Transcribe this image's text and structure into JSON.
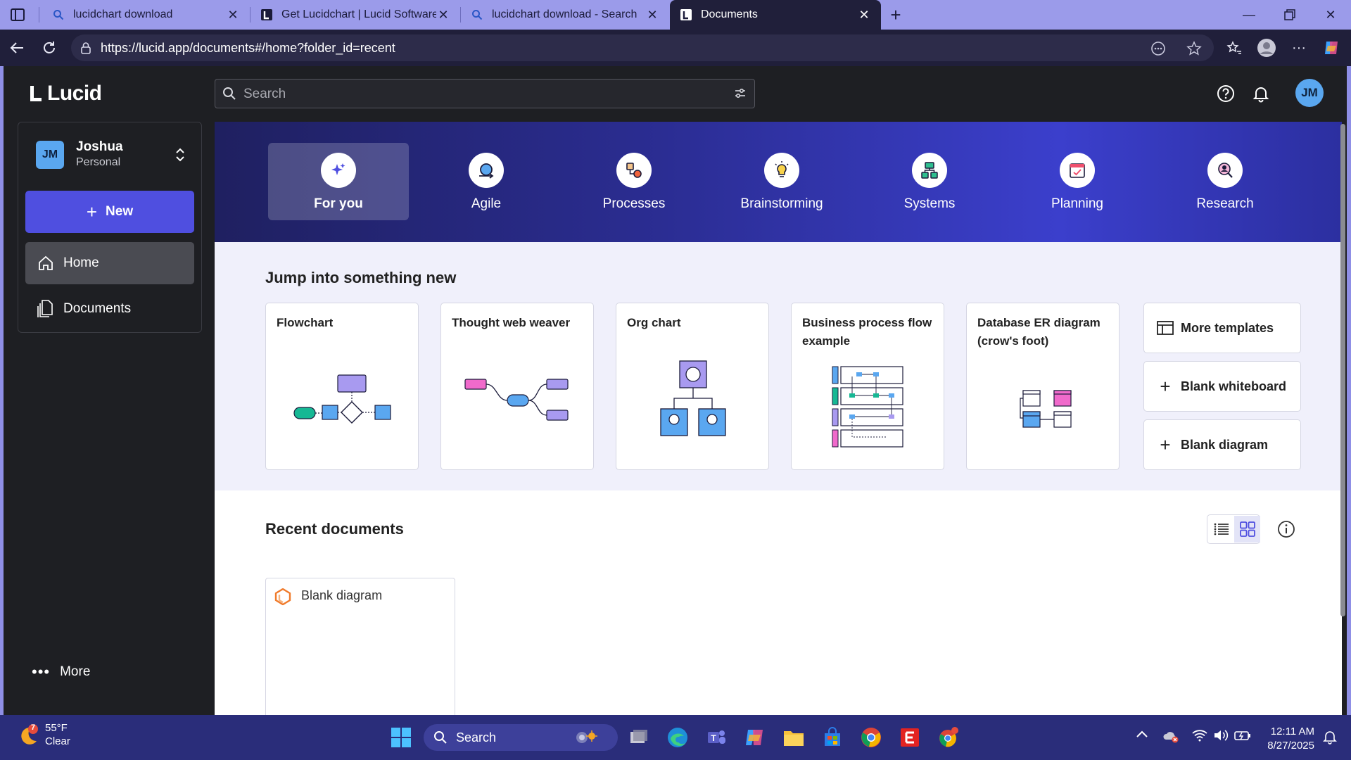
{
  "browser": {
    "tabs": [
      {
        "title": "lucidchart download",
        "favicon": "search-icon"
      },
      {
        "title": "Get Lucidchart | Lucid Software",
        "favicon": "lucid-icon"
      },
      {
        "title": "lucidchart download - Search",
        "favicon": "search-icon"
      },
      {
        "title": "Documents",
        "favicon": "lucid-icon",
        "active": true
      }
    ],
    "url": "https://lucid.app/documents#/home?folder_id=recent"
  },
  "header": {
    "logo": "Lucid",
    "search_placeholder": "Search",
    "avatar_initials": "JM"
  },
  "sidebar": {
    "account": {
      "initials": "JM",
      "name": "Joshua",
      "type": "Personal"
    },
    "new_label": "New",
    "items": [
      {
        "label": "Home",
        "icon": "home-icon",
        "active": true
      },
      {
        "label": "Documents",
        "icon": "documents-icon"
      }
    ],
    "more_label": "More"
  },
  "categories": [
    {
      "label": "For you",
      "icon": "sparkle-icon",
      "active": true
    },
    {
      "label": "Agile",
      "icon": "agile-icon"
    },
    {
      "label": "Processes",
      "icon": "processes-icon"
    },
    {
      "label": "Brainstorming",
      "icon": "lightbulb-icon"
    },
    {
      "label": "Systems",
      "icon": "systems-icon"
    },
    {
      "label": "Planning",
      "icon": "calendar-icon"
    },
    {
      "label": "Research",
      "icon": "research-icon"
    }
  ],
  "jump": {
    "title": "Jump into something new",
    "templates": [
      {
        "title": "Flowchart"
      },
      {
        "title": "Thought web weaver"
      },
      {
        "title": "Org chart"
      },
      {
        "title": "Business process flow example"
      },
      {
        "title": "Database ER diagram (crow's foot)"
      }
    ],
    "more_templates": "More templates",
    "blank_whiteboard": "Blank whiteboard",
    "blank_diagram": "Blank diagram"
  },
  "recent": {
    "title": "Recent documents",
    "documents": [
      {
        "name": "Blank diagram"
      }
    ]
  },
  "taskbar": {
    "weather": {
      "badge": "7",
      "temp": "55°F",
      "condition": "Clear"
    },
    "search_label": "Search",
    "time": "12:11 AM",
    "date": "8/27/2025"
  },
  "colors": {
    "primary": "#4f4fe0",
    "banner_start": "#1f2060",
    "banner_end": "#3b3fcc",
    "avatar": "#5aa7f0"
  }
}
